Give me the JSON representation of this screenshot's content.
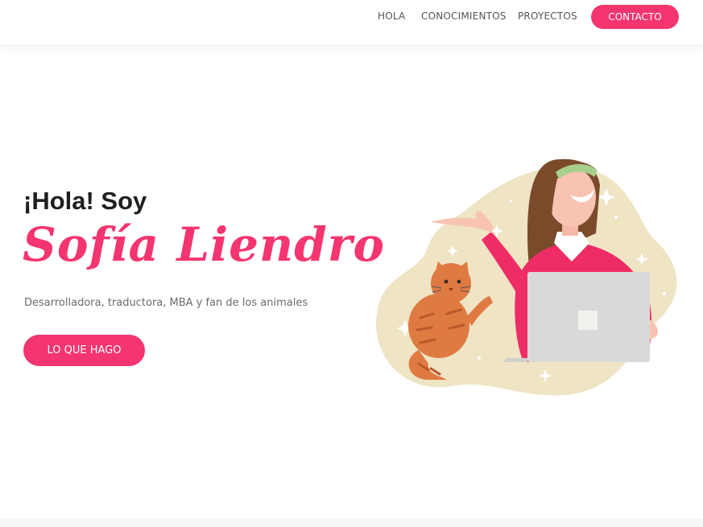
{
  "nav": {
    "items": [
      {
        "label": "HOLA"
      },
      {
        "label": "CONOCIMIENTOS"
      },
      {
        "label": "PROYECTOS"
      }
    ],
    "contact_label": "CONTACTO"
  },
  "hero": {
    "greeting": "¡Hola! Soy",
    "name": "Sofía Liendro",
    "tagline": "Desarrolladora, traductora, MBA y fan de los animales",
    "cta_label": "LO QUE HAGO"
  },
  "colors": {
    "accent": "#f4356f",
    "blob": "#efe4c4",
    "text_dark": "#1f1f1f",
    "text_muted": "#6b6b6b"
  },
  "illustration": {
    "icons": [
      "woman-illustration",
      "cat-illustration",
      "laptop-icon",
      "sparkle-icon"
    ]
  }
}
